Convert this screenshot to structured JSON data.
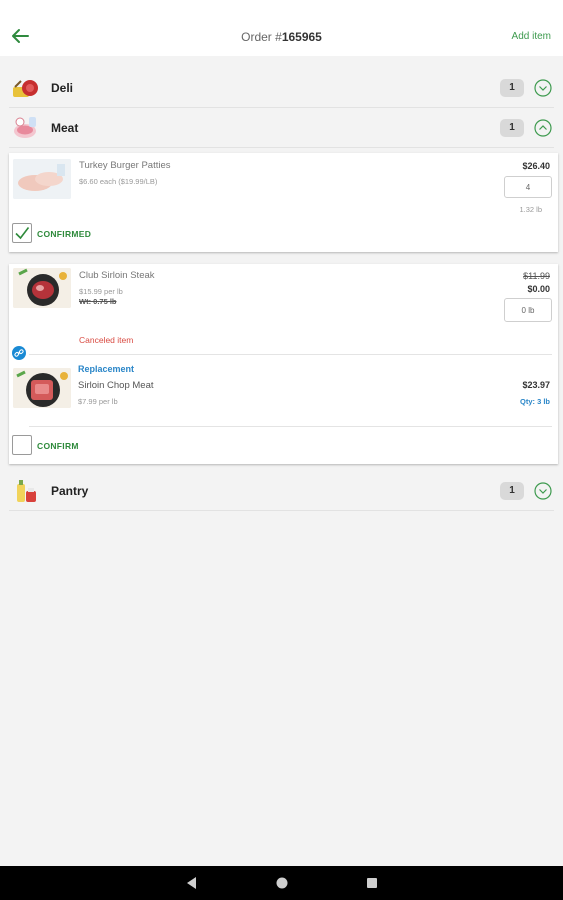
{
  "header": {
    "title_prefix": "Order #",
    "order_number": "165965",
    "add_item": "Add item"
  },
  "categories": [
    {
      "name": "Deli",
      "count": "1"
    },
    {
      "name": "Meat",
      "count": "1"
    },
    {
      "name": "Pantry",
      "count": "1"
    }
  ],
  "items": [
    {
      "name": "Turkey Burger Patties",
      "unit_price": "$6.60 each ($19.99/LB)",
      "price": "$26.40",
      "quantity": "4",
      "weight": "1.32 lb",
      "status": "CONFIRMED"
    },
    {
      "name": "Club Sirloin Steak",
      "unit_price": "$15.99 per lb",
      "weight_note": "Wt: 0.75 lb",
      "old_price": "$11.99",
      "price": "$0.00",
      "quantity": "0 lb",
      "note": "Canceled item",
      "replacement": {
        "label": "Replacement",
        "name": "Sirloin Chop Meat",
        "unit_price": "$7.99 per lb",
        "price": "$23.97",
        "qty": "Qty: 3 lb"
      },
      "status": "CONFIRM"
    }
  ],
  "colors": {
    "accent": "#3d9a4e",
    "link": "#2a86c8",
    "error": "#d94b42"
  }
}
